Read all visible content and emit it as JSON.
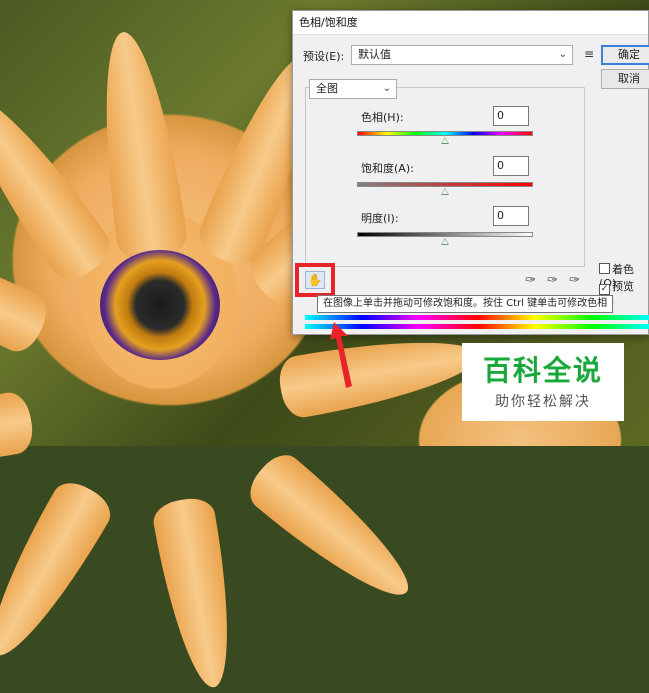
{
  "dialog": {
    "title": "色相/饱和度",
    "preset_label": "预设(E):",
    "preset_value": "默认值",
    "preset_menu_icon": "list-settings-icon",
    "ok_label": "确定",
    "cancel_label": "取消",
    "channel_value": "全图",
    "hue_label": "色相(H):",
    "hue_value": "0",
    "saturation_label": "饱和度(A):",
    "saturation_value": "0",
    "lightness_label": "明度(I):",
    "lightness_value": "0",
    "colorize_label": "着色(O)",
    "preview_label": "预览(P)",
    "preview_checked": true,
    "tooltip": "在图像上单击并拖动可修改饱和度。按住 Ctrl 键单击可修改色相",
    "hand_tool_icon": "hand-adjust-icon",
    "eyedropper_icons": [
      "eyedropper-icon",
      "eyedropper-plus-icon",
      "eyedropper-minus-icon"
    ],
    "slider_positions": {
      "hue": 0.5,
      "saturation": 0.5,
      "lightness": 0.5
    }
  },
  "annotation": {
    "highlight_color": "#e8242b",
    "arrow_color": "#e8242b"
  },
  "watermark": {
    "title": "百科全说",
    "subtitle": "助你轻松解决",
    "title_color": "#1aa83a"
  }
}
